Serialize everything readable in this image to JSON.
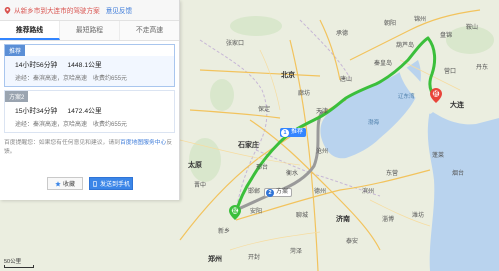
{
  "header": {
    "from_text": "从新乡市到大连市的驾驶方案",
    "feedback_link": "意见反馈"
  },
  "tabs": [
    {
      "label": "推荐路线",
      "active": true
    },
    {
      "label": "最短路程",
      "active": false
    },
    {
      "label": "不走高速",
      "active": false
    }
  ],
  "plans": [
    {
      "tag": "推荐",
      "duration": "14小时56分钟",
      "distance": "1448.1公里",
      "via": "途经：秦滨高速，京哈高速",
      "toll": "收费约655元"
    },
    {
      "tag": "方案2",
      "duration": "15小时34分钟",
      "distance": "1472.4公里",
      "via": "途经：秦滨高速，京哈高速",
      "toll": "收费约655元"
    }
  ],
  "feedback": {
    "text": "百度提醒您：如果您有任何意见和建议，请到",
    "link": "百度地图服务中心",
    "suffix": "反馈。"
  },
  "actions": {
    "favorite": "收藏",
    "send_phone": "发送到手机"
  },
  "map": {
    "route_labels": [
      {
        "num": "1",
        "text": "推荐"
      },
      {
        "num": "2",
        "text": "方案"
      }
    ],
    "cities": {
      "beijing": "北京",
      "tianjin": "天津",
      "shijiazhuang": "石家庄",
      "tangshan": "唐山",
      "qinhuangdao": "秦皇岛",
      "jinzhou": "锦州",
      "yingkou": "营口",
      "dalian": "大连",
      "cangzhou": "沧州",
      "baoding": "保定",
      "hengshui": "衡水",
      "dezhou": "德州",
      "jinan": "济南",
      "zibo": "淄博",
      "weifang": "潍坊",
      "handan": "邯郸",
      "xingtai": "邢台",
      "anyang": "安阳",
      "xinxiang": "新乡",
      "zhengzhou": "郑州",
      "kaifeng": "开封",
      "liaocheng": "聊城",
      "heze": "菏泽",
      "taian": "泰安",
      "binzhou": "滨州",
      "dongying": "东营",
      "yantai": "烟台",
      "penglai": "蓬莱",
      "chengde": "承德",
      "zhangjiakou": "张家口",
      "taiyuan": "太原",
      "jinzhong": "晋中",
      "chaoyang": "朝阳",
      "huludao": "葫芦岛",
      "panjin": "盘锦",
      "anshan": "鞍山",
      "dandong": "丹东",
      "langfang": "廊坊"
    },
    "sea": {
      "bohai": "渤海",
      "liaodong": "辽东湾"
    },
    "scale": "50公里",
    "route_color_primary": "#3bbf3b",
    "route_color_secondary": "#9a9a9a"
  }
}
